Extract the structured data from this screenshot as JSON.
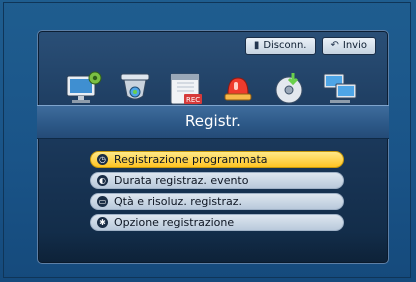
{
  "topbar": {
    "disconnect_label": "Disconn.",
    "send_label": "Invio"
  },
  "icons": [
    "monitor-settings-icon",
    "dome-camera-icon",
    "recording-calendar-icon",
    "alarm-siren-icon",
    "disc-backup-icon",
    "network-icon"
  ],
  "header": {
    "title": "Registr."
  },
  "menu": {
    "items": [
      {
        "label": "Registrazione programmata",
        "icon": "clock-icon",
        "selected": true
      },
      {
        "label": "Durata registraz. evento",
        "icon": "timer-icon",
        "selected": false
      },
      {
        "label": "Qtà e risoluz. registraz.",
        "icon": "resolution-icon",
        "selected": false
      },
      {
        "label": "Opzione registrazione",
        "icon": "gear-icon",
        "selected": false
      }
    ]
  },
  "colors": {
    "selected_accent": "#ffc423",
    "background": "#1a5488"
  }
}
